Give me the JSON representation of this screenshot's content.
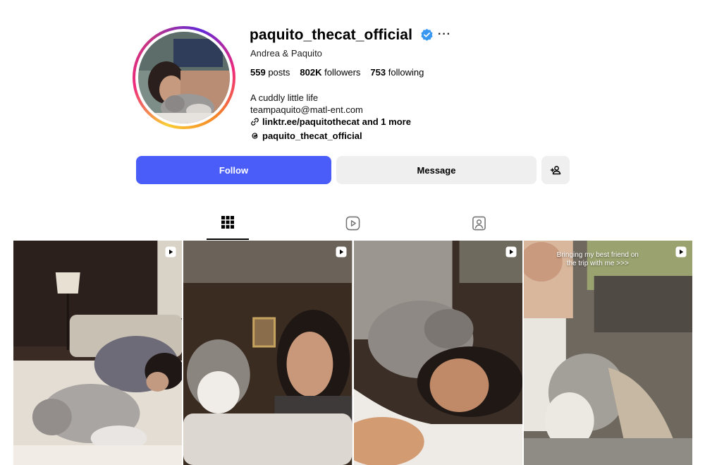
{
  "profile": {
    "username": "paquito_thecat_official",
    "more_icon": "···",
    "full_name": "Andrea & Paquito",
    "stats": {
      "posts_count": "559",
      "posts_label": "posts",
      "followers_count": "802K",
      "followers_label": "followers",
      "following_count": "753",
      "following_label": "following"
    },
    "bio_line1": "A cuddly little life",
    "bio_line2": "teampaquito@matl-ent.com",
    "link_text": "linktr.ee/paquitothecat and 1 more",
    "threads_handle": "paquito_thecat_official"
  },
  "actions": {
    "follow_label": "Follow",
    "message_label": "Message",
    "add_user_icon": "add-user-icon"
  },
  "tabs": [
    {
      "name": "posts",
      "icon": "grid-icon",
      "active": true
    },
    {
      "name": "reels",
      "icon": "reels-icon",
      "active": false
    },
    {
      "name": "tagged",
      "icon": "tagged-icon",
      "active": false
    }
  ],
  "posts": [
    {
      "type": "reel",
      "overlay_text": ""
    },
    {
      "type": "reel",
      "overlay_text": ""
    },
    {
      "type": "reel",
      "overlay_text": ""
    },
    {
      "type": "reel",
      "overlay_text": "Bringing my best friend on the trip with me >>>"
    }
  ],
  "colors": {
    "follow_button": "#4a5df9",
    "secondary_button": "#efefef",
    "verified_badge": "#3897f0"
  }
}
